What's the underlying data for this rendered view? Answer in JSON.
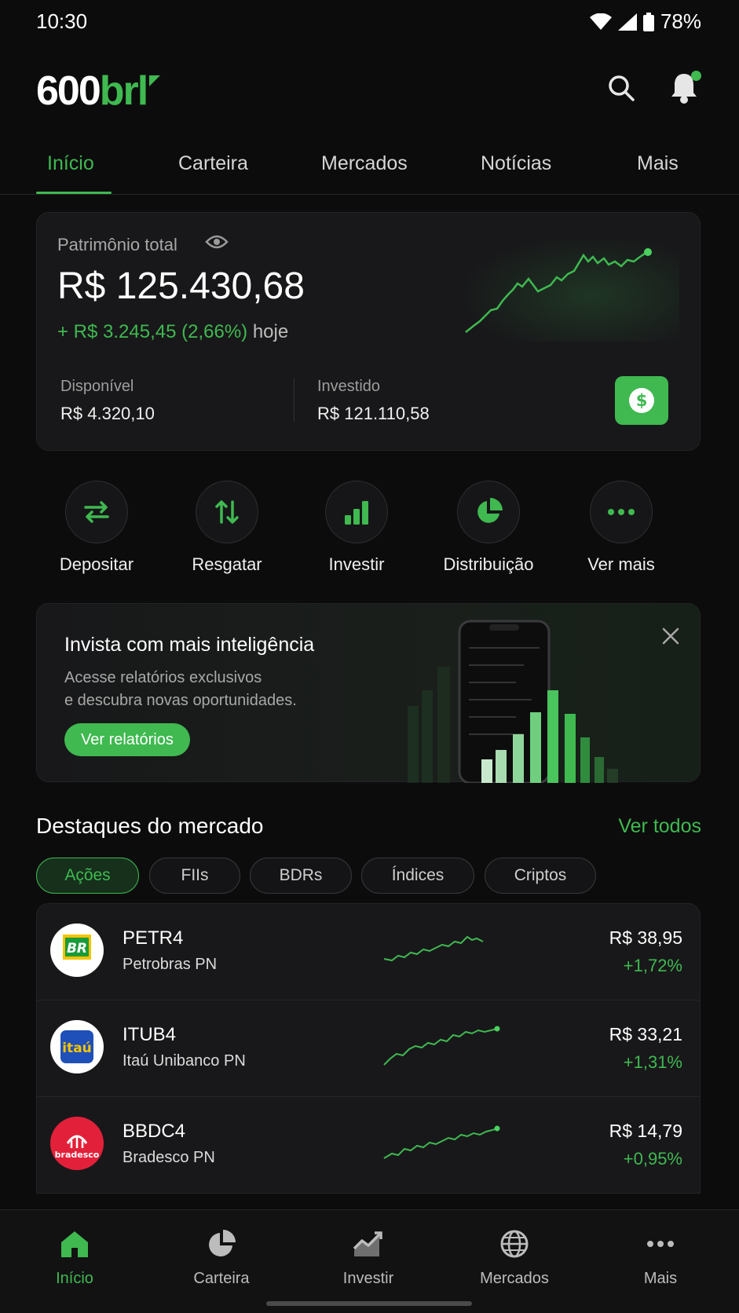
{
  "status": {
    "time": "10:30",
    "battery": "78%"
  },
  "header": {
    "logo_a": "600",
    "logo_b": "brl"
  },
  "tabs": [
    {
      "label": "Início"
    },
    {
      "label": "Carteira"
    },
    {
      "label": "Mercados"
    },
    {
      "label": "Notícias"
    },
    {
      "label": "Mais"
    }
  ],
  "patrimonio": {
    "label": "Patrimônio total",
    "total": "R$ 125.430,68",
    "delta": "+ R$ 3.245,45 (2,66%)",
    "delta_suffix": "hoje",
    "disponivel_label": "Disponível",
    "disponivel_value": "R$ 4.320,10",
    "investido_label": "Investido",
    "investido_value": "R$ 121.110,58"
  },
  "actions": [
    {
      "label": "Depositar",
      "icon": "transfer-arrows-icon"
    },
    {
      "label": "Resgatar",
      "icon": "up-down-arrows-icon"
    },
    {
      "label": "Investir",
      "icon": "bar-chart-icon"
    },
    {
      "label": "Distribuição",
      "icon": "pie-chart-icon"
    },
    {
      "label": "Ver mais",
      "icon": "more-dots-icon"
    }
  ],
  "promo": {
    "title": "Invista com mais inteligência",
    "sub_line1": "Acesse relatórios exclusivos",
    "sub_line2": "e descubra novas oportunidades.",
    "button": "Ver relatórios"
  },
  "market": {
    "title": "Destaques do mercado",
    "link": "Ver todos",
    "chips": [
      "Ações",
      "FIIs",
      "BDRs",
      "Índices",
      "Criptos"
    ],
    "rows": [
      {
        "ticker": "PETR4",
        "name": "Petrobras PN",
        "price": "R$ 38,95",
        "change": "+1,72%",
        "logo_text": "BR"
      },
      {
        "ticker": "ITUB4",
        "name": "Itaú Unibanco PN",
        "price": "R$ 33,21",
        "change": "+1,31%",
        "logo_text": "itaú"
      },
      {
        "ticker": "BBDC4",
        "name": "Bradesco PN",
        "price": "R$ 14,79",
        "change": "+0,95%",
        "logo_text": "bradesco"
      }
    ]
  },
  "bottom_nav": [
    {
      "label": "Início",
      "icon": "home-icon"
    },
    {
      "label": "Carteira",
      "icon": "pie-chart-icon"
    },
    {
      "label": "Investir",
      "icon": "trend-chart-icon"
    },
    {
      "label": "Mercados",
      "icon": "globe-icon"
    },
    {
      "label": "Mais",
      "icon": "more-dots-icon"
    }
  ],
  "colors": {
    "accent": "#3fb950",
    "background": "#0c0c0d",
    "card": "#18181a"
  }
}
